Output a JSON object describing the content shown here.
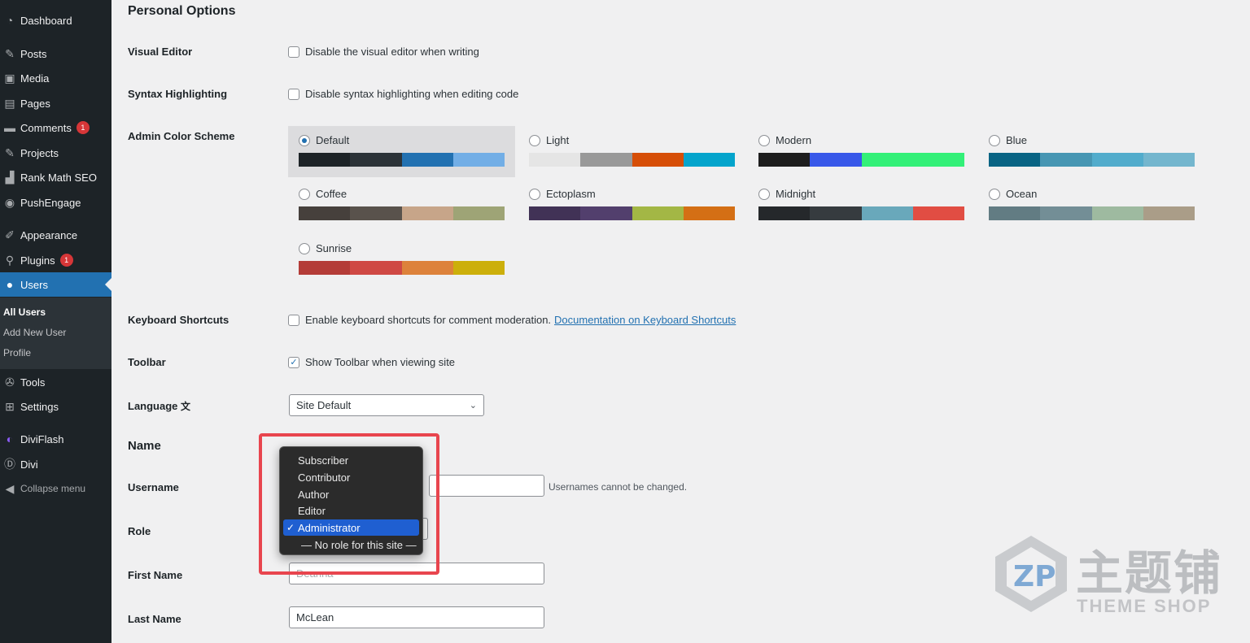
{
  "sidebar": {
    "items": [
      {
        "label": "Dashboard",
        "icon": "dashboard-icon"
      },
      {
        "label": "Posts",
        "icon": "pin-icon"
      },
      {
        "label": "Media",
        "icon": "media-icon"
      },
      {
        "label": "Pages",
        "icon": "pages-icon"
      },
      {
        "label": "Comments",
        "icon": "comment-icon",
        "badge": "1"
      },
      {
        "label": "Projects",
        "icon": "pin-icon"
      },
      {
        "label": "Rank Math SEO",
        "icon": "chart-icon"
      },
      {
        "label": "PushEngage",
        "icon": "broadcast-icon"
      },
      {
        "label": "Appearance",
        "icon": "brush-icon"
      },
      {
        "label": "Plugins",
        "icon": "plugin-icon",
        "badge": "1"
      },
      {
        "label": "Users",
        "icon": "user-icon"
      },
      {
        "label": "Tools",
        "icon": "wrench-icon"
      },
      {
        "label": "Settings",
        "icon": "settings-icon"
      },
      {
        "label": "DiviFlash",
        "icon": "diviflash-icon"
      },
      {
        "label": "Divi",
        "icon": "divi-icon"
      },
      {
        "label": "Collapse menu",
        "icon": "collapse-icon"
      }
    ],
    "submenu": [
      "All Users",
      "Add New User",
      "Profile"
    ]
  },
  "main": {
    "personal_options_title": "Personal Options",
    "visual_editor": {
      "label": "Visual Editor",
      "text": "Disable the visual editor when writing",
      "checked": false
    },
    "syntax": {
      "label": "Syntax Highlighting",
      "text": "Disable syntax highlighting when editing code",
      "checked": false
    },
    "color_scheme_label": "Admin Color Scheme",
    "schemes": [
      {
        "name": "Default",
        "selected": true,
        "colors": [
          "#1d2327",
          "#2c3338",
          "#2271b1",
          "#72aee6"
        ]
      },
      {
        "name": "Light",
        "selected": false,
        "colors": [
          "#e5e5e5",
          "#999999",
          "#d64e07",
          "#04a4cc"
        ]
      },
      {
        "name": "Modern",
        "selected": false,
        "colors": [
          "#1e1e1e",
          "#3858e9",
          "#33f078",
          "#33f078"
        ]
      },
      {
        "name": "Blue",
        "selected": false,
        "colors": [
          "#096484",
          "#4796b3",
          "#52accc",
          "#74b6ce"
        ]
      },
      {
        "name": "Coffee",
        "selected": false,
        "colors": [
          "#46403c",
          "#59524c",
          "#c7a589",
          "#9ea476"
        ]
      },
      {
        "name": "Ectoplasm",
        "selected": false,
        "colors": [
          "#413256",
          "#523f6d",
          "#a3b745",
          "#d46f15"
        ]
      },
      {
        "name": "Midnight",
        "selected": false,
        "colors": [
          "#25282b",
          "#363b3f",
          "#69a8bb",
          "#e14d43"
        ]
      },
      {
        "name": "Ocean",
        "selected": false,
        "colors": [
          "#627c83",
          "#738e96",
          "#9ebaa0",
          "#aa9d88"
        ]
      },
      {
        "name": "Sunrise",
        "selected": false,
        "colors": [
          "#b43c38",
          "#cf4944",
          "#dd823b",
          "#ccaf0b"
        ]
      }
    ],
    "keyboard": {
      "label": "Keyboard Shortcuts",
      "text": "Enable keyboard shortcuts for comment moderation.",
      "link": "Documentation on Keyboard Shortcuts",
      "checked": false
    },
    "toolbar": {
      "label": "Toolbar",
      "text": "Show Toolbar when viewing site",
      "checked": true
    },
    "language": {
      "label": "Language",
      "value": "Site Default"
    },
    "name_title": "Name",
    "username": {
      "label": "Username",
      "value": "",
      "desc": "Usernames cannot be changed."
    },
    "role": {
      "label": "Role",
      "options": [
        "Subscriber",
        "Contributor",
        "Author",
        "Editor",
        "Administrator",
        "— No role for this site —"
      ],
      "selected": "Administrator"
    },
    "first_name": {
      "label": "First Name",
      "value": "Deanna"
    },
    "last_name": {
      "label": "Last Name",
      "value": "McLean"
    }
  },
  "watermark": {
    "cn": "主题铺",
    "en": "THEME SHOP"
  }
}
